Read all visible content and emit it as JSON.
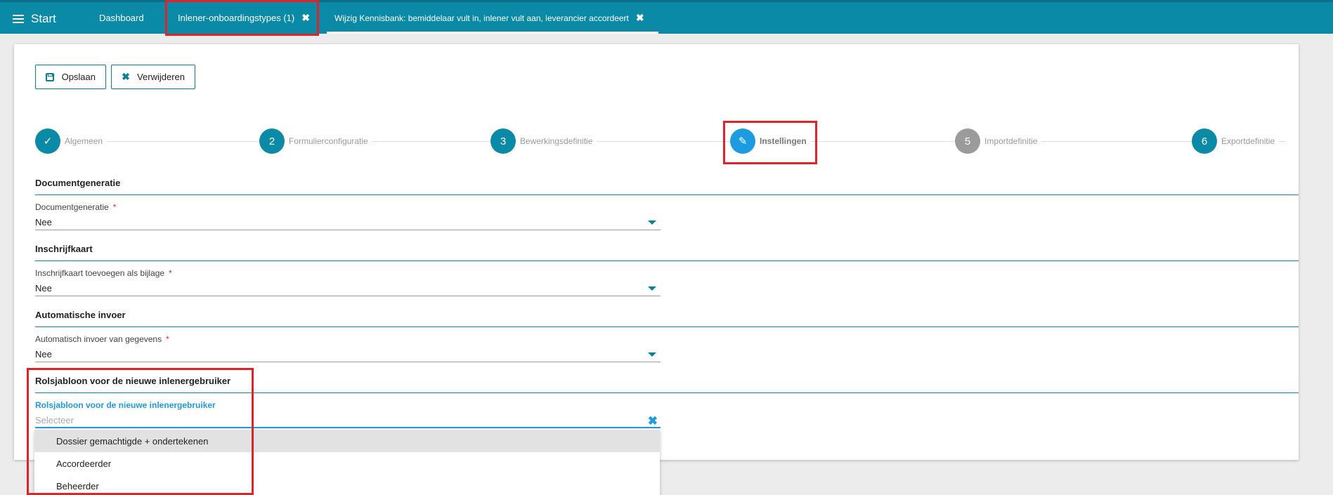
{
  "topbar": {
    "menu_label": "Start",
    "tabs": [
      {
        "label": "Dashboard"
      },
      {
        "label": "Inlener-onboardingstypes (1)",
        "close": "✖"
      },
      {
        "label": "Wijzig Kennisbank: bemiddelaar vult in, inlener vult aan, leverancier accordeert",
        "close": "✖"
      }
    ]
  },
  "toolbar": {
    "save_label": "Opslaan",
    "delete_label": "Verwijderen"
  },
  "stepper": {
    "steps": [
      {
        "number": "✓",
        "label": "Algemeen",
        "state": "done"
      },
      {
        "number": "2",
        "label": "Formulierconfiguratie",
        "state": "todo"
      },
      {
        "number": "3",
        "label": "Bewerkingsdefinitie",
        "state": "todo"
      },
      {
        "number": "✎",
        "label": "Instellingen",
        "state": "active"
      },
      {
        "number": "5",
        "label": "Importdefinitie",
        "state": "disabled"
      },
      {
        "number": "6",
        "label": "Exportdefinitie",
        "state": "todo"
      }
    ]
  },
  "sections": [
    {
      "title": "Documentgeneratie",
      "field_label": "Documentgeneratie",
      "required": "*",
      "value": "Nee"
    },
    {
      "title": "Inschrijfkaart",
      "field_label": "Inschrijfkaart toevoegen als bijlage",
      "required": "*",
      "value": "Nee"
    },
    {
      "title": "Automatische invoer",
      "field_label": "Automatisch invoer van gegevens",
      "required": "*",
      "value": "Nee"
    },
    {
      "title": "Rolsjabloon voor de nieuwe inlenergebruiker",
      "field_label": "Rolsjabloon voor de nieuwe inlenergebruiker",
      "placeholder": "Selecteer",
      "clear": "✖"
    }
  ],
  "dropdown": {
    "options": [
      "Dossier gemachtigde + ondertekenen",
      "Accordeerder",
      "Beheerder"
    ]
  },
  "colors": {
    "accent": "#0a8aa7",
    "focus": "#1c9be0",
    "highlight": "#e0232b"
  }
}
